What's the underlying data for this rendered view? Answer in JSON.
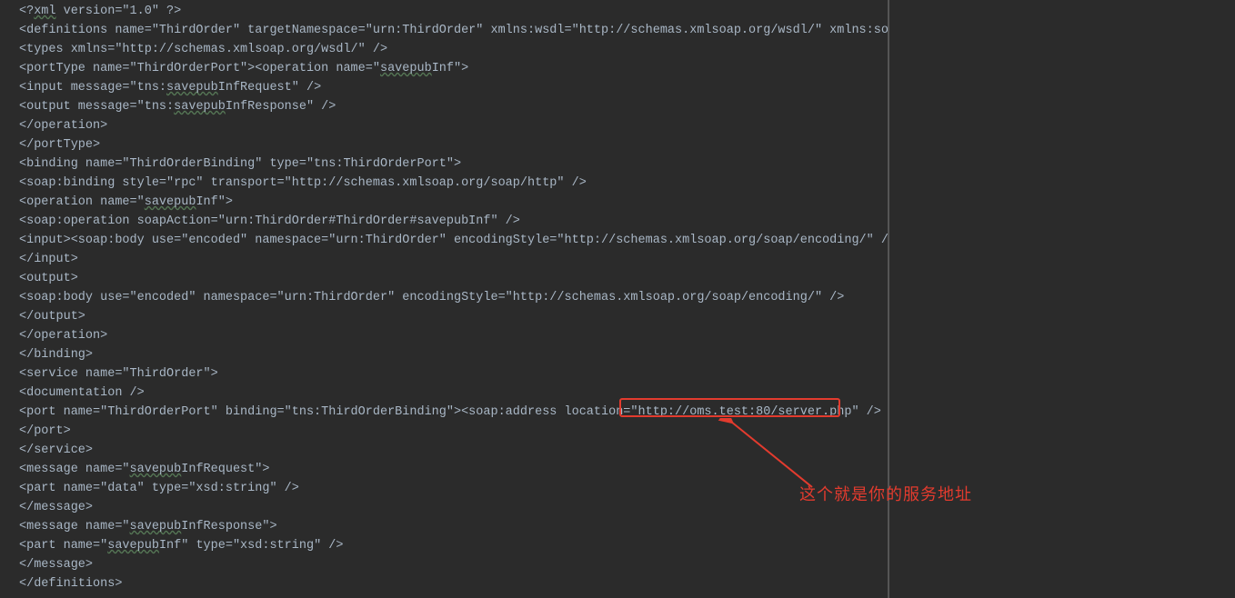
{
  "annotation": {
    "label": "这个就是你的服务地址",
    "highlighted_url": "http://oms.test:80/server.php"
  },
  "code_lines": [
    {
      "left": "<?",
      "tok": "xml",
      "right": " version=\"1.0\" ?>"
    },
    {
      "plain": "<definitions name=\"ThirdOrder\" targetNamespace=\"urn:ThirdOrder\" xmlns:wsdl=\"http://schemas.xmlsoap.org/wsdl/\" xmlns:soap=\"http://schemas.xmlsoap.org/wsdl/soap/\" xmlns:t"
    },
    {
      "plain": "<types xmlns=\"http://schemas.xmlsoap.org/wsdl/\" />"
    },
    {
      "left": "<portType name=\"ThirdOrderPort\"><operation name=\"",
      "tok": "savepub",
      "right": "Inf\">"
    },
    {
      "left": "<input message=\"tns:",
      "tok": "savepub",
      "right": "InfRequest\" />"
    },
    {
      "left": "<output message=\"tns:",
      "tok": "savepub",
      "right": "InfResponse\" />"
    },
    {
      "plain": "</operation>"
    },
    {
      "plain": "</portType>"
    },
    {
      "plain": "<binding name=\"ThirdOrderBinding\" type=\"tns:ThirdOrderPort\">"
    },
    {
      "plain": "<soap:binding style=\"rpc\" transport=\"http://schemas.xmlsoap.org/soap/http\" />"
    },
    {
      "left": "<operation name=\"",
      "tok": "savepub",
      "right": "Inf\">"
    },
    {
      "plain": "<soap:operation soapAction=\"urn:ThirdOrder#ThirdOrder#savepubInf\" />"
    },
    {
      "plain": "<input><soap:body use=\"encoded\" namespace=\"urn:ThirdOrder\" encodingStyle=\"http://schemas.xmlsoap.org/soap/encoding/\" />"
    },
    {
      "plain": "</input>"
    },
    {
      "plain": "<output>"
    },
    {
      "plain": "<soap:body use=\"encoded\" namespace=\"urn:ThirdOrder\" encodingStyle=\"http://schemas.xmlsoap.org/soap/encoding/\" />"
    },
    {
      "plain": "</output>"
    },
    {
      "plain": "</operation>"
    },
    {
      "plain": "</binding>"
    },
    {
      "plain": "<service name=\"ThirdOrder\">"
    },
    {
      "plain": "<documentation />"
    },
    {
      "plain": "<port name=\"ThirdOrderPort\" binding=\"tns:ThirdOrderBinding\"><soap:address location=\"http://oms.test:80/server.php\" />"
    },
    {
      "plain": "</port>"
    },
    {
      "plain": "</service>"
    },
    {
      "left": "<message name=\"",
      "tok": "savepub",
      "right": "InfRequest\">"
    },
    {
      "plain": "<part name=\"data\" type=\"xsd:string\" />"
    },
    {
      "plain": "</message>"
    },
    {
      "left": "<message name=\"",
      "tok": "savepub",
      "right": "InfResponse\">"
    },
    {
      "left": "<part name=\"",
      "tok": "savepub",
      "right": "Inf\" type=\"xsd:string\" />"
    },
    {
      "plain": "</message>"
    },
    {
      "plain": "</definitions>"
    }
  ],
  "colors": {
    "bg": "#2b2b2b",
    "fg": "#a9b7c6",
    "annotation": "#e33b2e"
  }
}
